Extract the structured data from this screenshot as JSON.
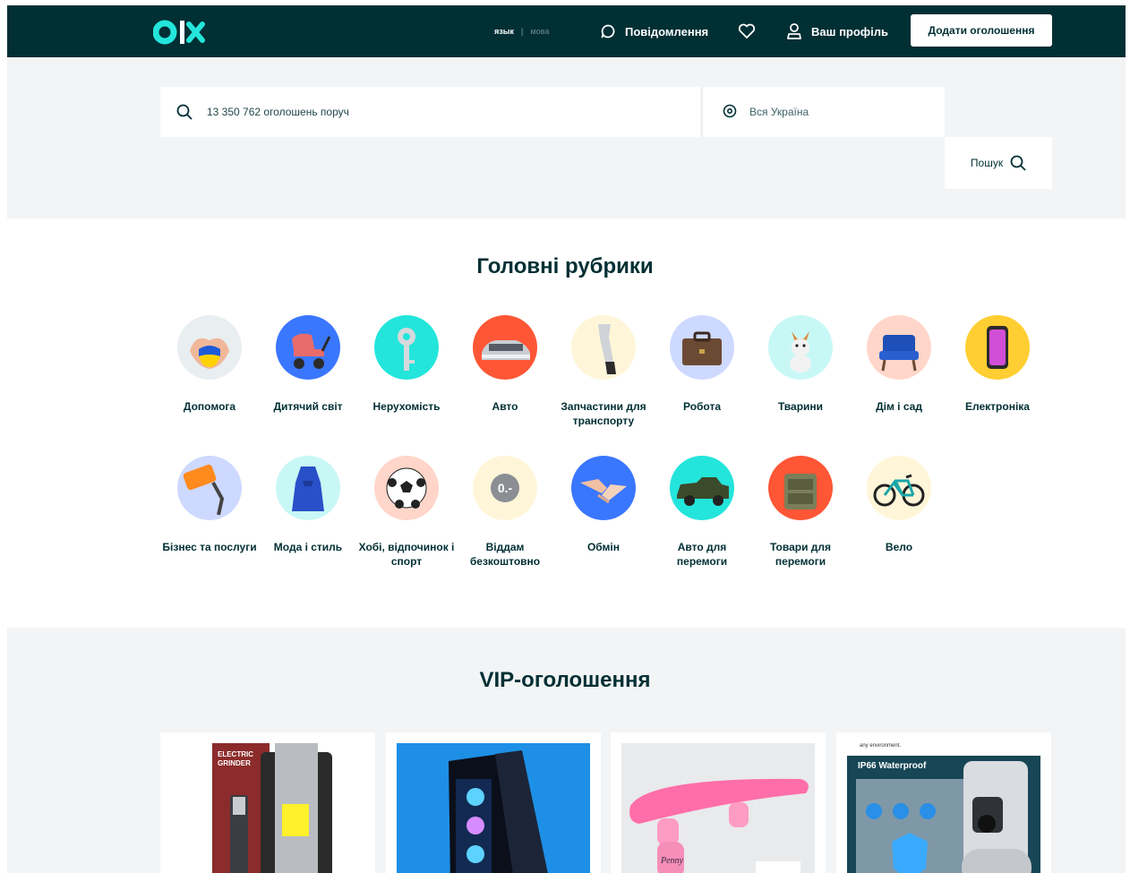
{
  "header": {
    "logo_text": "olx",
    "lang_ru": "язык",
    "lang_ua": "мова",
    "messages": "Повідомлення",
    "profile": "Ваш профіль",
    "add_listing": "Додати оголошення"
  },
  "search": {
    "placeholder": "13 350 762 оголошень поруч",
    "location_placeholder": "Вся Україна",
    "button": "Пошук"
  },
  "categories_title": "Головні рубрики",
  "categories": [
    {
      "label": "Допомога",
      "icon": "hands-heart-icon",
      "bg": "#e9eef1"
    },
    {
      "label": "Дитячий світ",
      "icon": "stroller-icon",
      "bg": "#3a77ff"
    },
    {
      "label": "Нерухомість",
      "icon": "key-icon",
      "bg": "#23e5db"
    },
    {
      "label": "Авто",
      "icon": "car-icon",
      "bg": "#ff5636"
    },
    {
      "label": "Запчастини для транспорту",
      "icon": "wrench-icon",
      "bg": "#fff6d9"
    },
    {
      "label": "Робота",
      "icon": "briefcase-icon",
      "bg": "#ced9ff"
    },
    {
      "label": "Тварини",
      "icon": "dog-icon",
      "bg": "#c8f8f6"
    },
    {
      "label": "Дім і сад",
      "icon": "armchair-icon",
      "bg": "#ffd6c9"
    },
    {
      "label": "Електроніка",
      "icon": "phone-icon",
      "bg": "#ffce32"
    },
    {
      "label": "Бізнес та послуги",
      "icon": "paint-roller-icon",
      "bg": "#ced9ff"
    },
    {
      "label": "Мода і стиль",
      "icon": "dress-icon",
      "bg": "#c8f8f6"
    },
    {
      "label": "Хобі, відпочинок і спорт",
      "icon": "soccer-ball-icon",
      "bg": "#ffd6c9"
    },
    {
      "label": "Віддам безкоштовно",
      "icon": "free-coin-icon",
      "bg": "#fff6d9"
    },
    {
      "label": "Обмін",
      "icon": "handshake-icon",
      "bg": "#3a77ff"
    },
    {
      "label": "Авто для перемоги",
      "icon": "pickup-truck-icon",
      "bg": "#23e5db"
    },
    {
      "label": "Товари для перемоги",
      "icon": "military-goods-icon",
      "bg": "#ff5636"
    },
    {
      "label": "Вело",
      "icon": "bicycle-icon",
      "bg": "#fff6d9"
    }
  ],
  "vip_title": "VIP-оголошення",
  "vip": [
    {
      "image_text": "ELECTRIC GRINDER",
      "icon": "grinder-product-icon"
    },
    {
      "image_text": "",
      "icon": "pc-case-product-icon"
    },
    {
      "image_text": "Penny",
      "icon": "skateboard-product-icon"
    },
    {
      "image_text": "IP66 Waterproof",
      "caption": "any environment.",
      "icon": "security-camera-product-icon"
    }
  ],
  "colors": {
    "brand_dark": "#002f34",
    "brand_teal": "#23e5db",
    "band_bg": "#f2f4f5"
  }
}
